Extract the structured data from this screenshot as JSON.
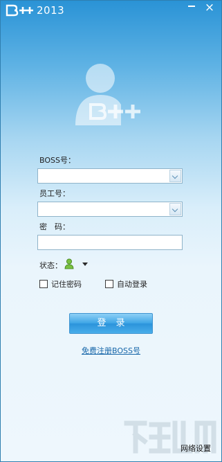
{
  "window": {
    "title": "2013",
    "logo": "B++",
    "min_icon": "minimize-icon",
    "close_label": "×"
  },
  "form": {
    "boss_label": "BOSS号：",
    "boss_value": "",
    "employee_label": "员工号：",
    "employee_value": "",
    "password_label": "密　码：",
    "password_value": "",
    "status_label": "状态：",
    "status_icon": "online-user-icon",
    "remember_label": "记住密码",
    "remember_checked": false,
    "autologin_label": "自动登录",
    "autologin_checked": false
  },
  "actions": {
    "login_label": "登录",
    "register_label": "免费注册BOSS号",
    "network_label": "网络设置"
  },
  "colors": {
    "accent": "#2a93db",
    "link": "#1565a8",
    "status_green": "#7ac142"
  }
}
